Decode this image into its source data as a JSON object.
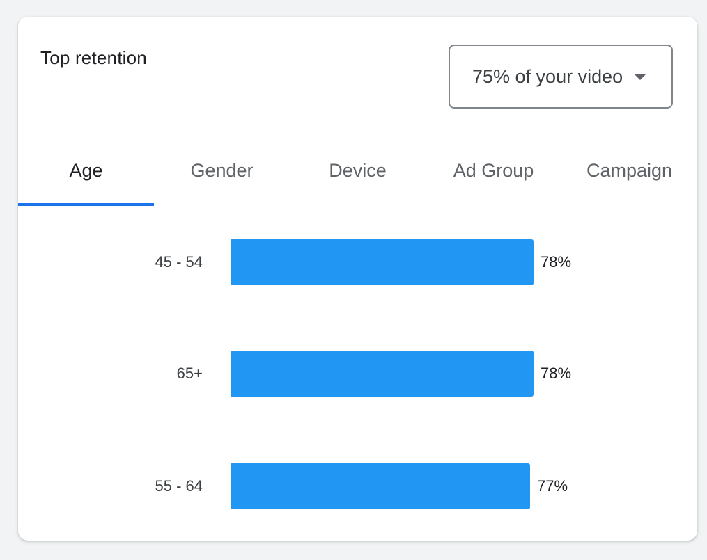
{
  "card": {
    "title": "Top retention",
    "dropdown": {
      "selected": "75% of your video",
      "icon": "arrow-drop-down-icon"
    }
  },
  "tabs": [
    {
      "label": "Age",
      "active": true
    },
    {
      "label": "Gender",
      "active": false
    },
    {
      "label": "Device",
      "active": false
    },
    {
      "label": "Ad Group",
      "active": false
    },
    {
      "label": "Campaign",
      "active": false
    }
  ],
  "colors": {
    "accent": "#1a73e8",
    "bar": "#2196f3"
  },
  "chart_data": {
    "type": "bar",
    "orientation": "horizontal",
    "title": "Top retention",
    "categories": [
      "45 - 54",
      "65+",
      "55 - 64"
    ],
    "values": [
      78,
      78,
      77
    ],
    "value_labels": [
      "78%",
      "78%",
      "77%"
    ],
    "unit": "%",
    "xlim": [
      0,
      100
    ],
    "grid": false
  }
}
